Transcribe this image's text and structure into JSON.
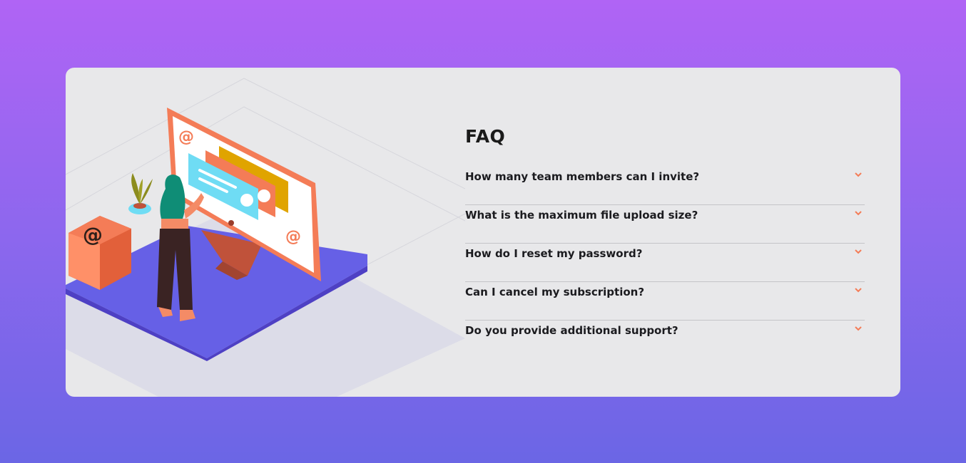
{
  "faq": {
    "title": "FAQ",
    "items": [
      {
        "question": "How many team members can I invite?",
        "icon": "chevron-down-icon"
      },
      {
        "question": "What is the maximum file upload size?",
        "icon": "chevron-down-icon"
      },
      {
        "question": "How do I reset my password?",
        "icon": "chevron-down-icon"
      },
      {
        "question": "Can I cancel my subscription?",
        "icon": "chevron-down-icon"
      },
      {
        "question": "Do you provide additional support?",
        "icon": "chevron-down-icon"
      }
    ]
  },
  "colors": {
    "background_top": "#b064f5",
    "background_bottom": "#6b66e5",
    "card": "#e8e8ea",
    "accent": "#f47c57",
    "text": "#1b1b1f",
    "divider": "#c4c4c8"
  }
}
